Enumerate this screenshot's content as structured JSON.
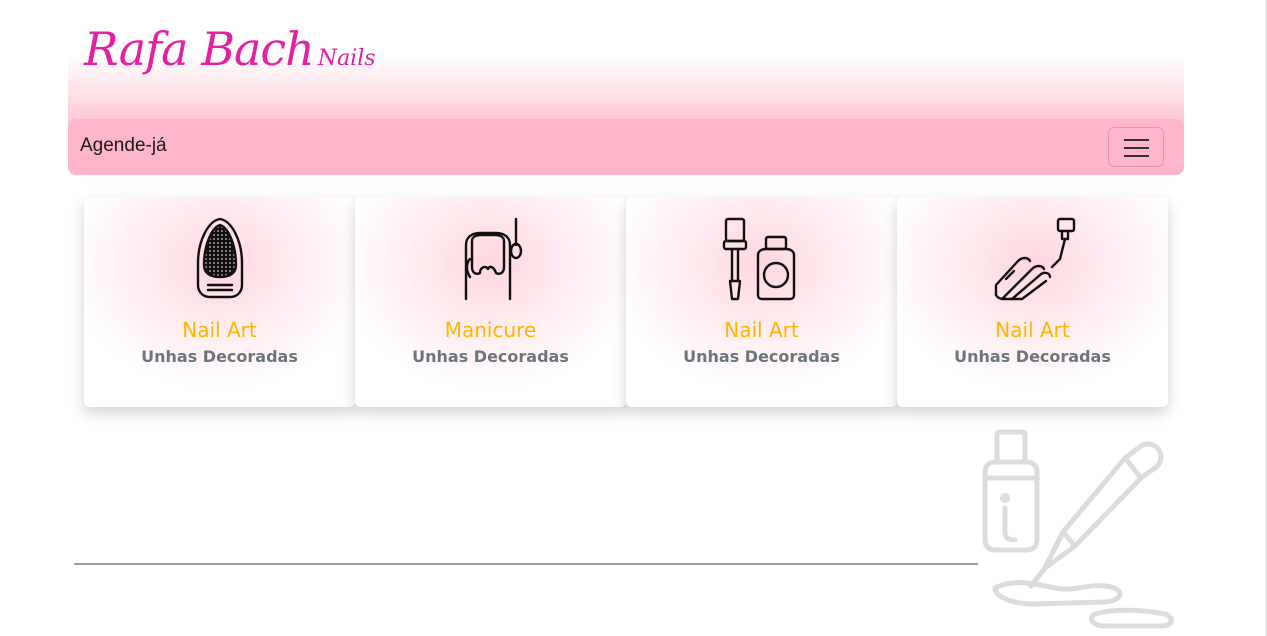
{
  "brand": {
    "name": "Rafa Bach",
    "suffix": "Nails"
  },
  "nav": {
    "link": "Agende-já",
    "toggle_label": "Toggle navigation"
  },
  "colors": {
    "brand": "#e31fa3",
    "navbar": "#ffb6c8",
    "card_title": "#ffb400",
    "card_subtitle": "#6c757d"
  },
  "cards": [
    {
      "icon": "decorated-nail-icon",
      "title": "Nail Art",
      "subtitle": "Unhas Decoradas"
    },
    {
      "icon": "manicure-nail-icon",
      "title": "Manicure",
      "subtitle": "Unhas Decoradas"
    },
    {
      "icon": "nail-polish-bottles-icon",
      "title": "Nail Art",
      "subtitle": "Unhas Decoradas"
    },
    {
      "icon": "hand-polish-icon",
      "title": "Nail Art",
      "subtitle": "Unhas Decoradas"
    }
  ],
  "footer": {
    "decoration_icon": "spilled-polish-icon"
  }
}
